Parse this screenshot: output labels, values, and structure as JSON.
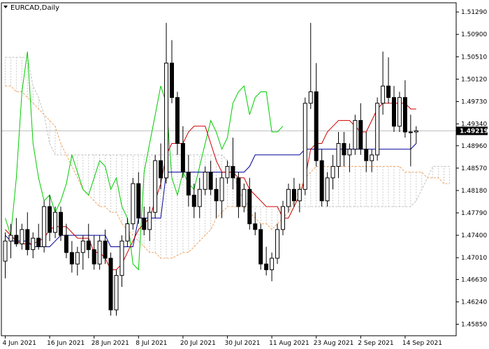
{
  "chart_data": {
    "type": "candlestick",
    "title": "EURCAD,Daily",
    "symbol": "EURCAD",
    "timeframe": "Daily",
    "current_price": 1.49219,
    "current_price_label": "1.49219",
    "ylim": [
      1.4565,
      1.5145
    ],
    "y_ticks": [
      "1.51290",
      "1.50900",
      "1.50510",
      "1.50120",
      "1.49730",
      "1.49340",
      "1.48960",
      "1.48570",
      "1.48180",
      "1.47790",
      "1.47400",
      "1.47010",
      "1.46630",
      "1.46240",
      "1.45850"
    ],
    "x_ticks": [
      {
        "index": 0,
        "label": "4 Jun 2021"
      },
      {
        "index": 8,
        "label": "16 Jun 2021"
      },
      {
        "index": 16,
        "label": "28 Jun 2021"
      },
      {
        "index": 24,
        "label": "8 Jul 2021"
      },
      {
        "index": 32,
        "label": "20 Jul 2021"
      },
      {
        "index": 40,
        "label": "30 Jul 2021"
      },
      {
        "index": 48,
        "label": "11 Aug 2021"
      },
      {
        "index": 56,
        "label": "23 Aug 2021"
      },
      {
        "index": 64,
        "label": "2 Sep 2021"
      },
      {
        "index": 72,
        "label": "14 Sep 2021"
      }
    ],
    "grid": false,
    "colors": {
      "bull_body": "#ffffff",
      "bear_body": "#000000",
      "wick": "#000000",
      "tenkan": "#cc0000",
      "kijun": "#000099",
      "chikou": "#00cc00",
      "span_a": "#f4a460",
      "span_b": "#c0c0c0",
      "price_line": "#c0c0c0",
      "badge_bg": "#000000"
    },
    "candles": [
      [
        1.4695,
        1.4745,
        1.4665,
        1.473
      ],
      [
        1.473,
        1.476,
        1.47,
        1.474
      ],
      [
        1.474,
        1.477,
        1.472,
        1.4725
      ],
      [
        1.4725,
        1.476,
        1.4715,
        1.475
      ],
      [
        1.475,
        1.478,
        1.4705,
        1.4715
      ],
      [
        1.4715,
        1.4745,
        1.47,
        1.4735
      ],
      [
        1.4735,
        1.476,
        1.4715,
        1.472
      ],
      [
        1.472,
        1.48,
        1.471,
        1.479
      ],
      [
        1.479,
        1.481,
        1.473,
        1.4745
      ],
      [
        1.4745,
        1.479,
        1.4735,
        1.478
      ],
      [
        1.478,
        1.479,
        1.473,
        1.474
      ],
      [
        1.474,
        1.476,
        1.47,
        1.471
      ],
      [
        1.471,
        1.473,
        1.4675,
        1.469
      ],
      [
        1.469,
        1.472,
        1.467,
        1.471
      ],
      [
        1.471,
        1.474,
        1.468,
        1.473
      ],
      [
        1.473,
        1.476,
        1.47,
        1.4715
      ],
      [
        1.4715,
        1.474,
        1.468,
        1.469
      ],
      [
        1.469,
        1.474,
        1.468,
        1.473
      ],
      [
        1.473,
        1.475,
        1.469,
        1.47
      ],
      [
        1.47,
        1.471,
        1.46,
        1.461
      ],
      [
        1.461,
        1.468,
        1.46,
        1.467
      ],
      [
        1.467,
        1.474,
        1.465,
        1.473
      ],
      [
        1.473,
        1.477,
        1.472,
        1.476
      ],
      [
        1.476,
        1.484,
        1.475,
        1.483
      ],
      [
        1.483,
        1.485,
        1.476,
        1.477
      ],
      [
        1.477,
        1.479,
        1.474,
        1.475
      ],
      [
        1.475,
        1.479,
        1.473,
        1.478
      ],
      [
        1.478,
        1.488,
        1.477,
        1.487
      ],
      [
        1.487,
        1.49,
        1.482,
        1.484
      ],
      [
        1.484,
        1.511,
        1.483,
        1.504
      ],
      [
        1.504,
        1.508,
        1.497,
        1.498
      ],
      [
        1.498,
        1.499,
        1.488,
        1.49
      ],
      [
        1.49,
        1.493,
        1.484,
        1.485
      ],
      [
        1.485,
        1.488,
        1.479,
        1.481
      ],
      [
        1.481,
        1.483,
        1.477,
        1.479
      ],
      [
        1.479,
        1.484,
        1.477,
        1.482
      ],
      [
        1.482,
        1.486,
        1.481,
        1.485
      ],
      [
        1.485,
        1.487,
        1.481,
        1.482
      ],
      [
        1.482,
        1.484,
        1.477,
        1.48
      ],
      [
        1.48,
        1.485,
        1.477,
        1.484
      ],
      [
        1.484,
        1.487,
        1.483,
        1.486
      ],
      [
        1.486,
        1.491,
        1.482,
        1.484
      ],
      [
        1.484,
        1.485,
        1.477,
        1.479
      ],
      [
        1.479,
        1.483,
        1.478,
        1.482
      ],
      [
        1.482,
        1.484,
        1.475,
        1.476
      ],
      [
        1.476,
        1.478,
        1.474,
        1.475
      ],
      [
        1.475,
        1.476,
        1.468,
        1.469
      ],
      [
        1.469,
        1.472,
        1.467,
        1.468
      ],
      [
        1.468,
        1.471,
        1.466,
        1.47
      ],
      [
        1.47,
        1.476,
        1.469,
        1.475
      ],
      [
        1.475,
        1.48,
        1.474,
        1.479
      ],
      [
        1.479,
        1.483,
        1.478,
        1.482
      ],
      [
        1.482,
        1.484,
        1.479,
        1.48
      ],
      [
        1.48,
        1.483,
        1.478,
        1.482
      ],
      [
        1.482,
        1.498,
        1.481,
        1.497
      ],
      [
        1.497,
        1.511,
        1.496,
        1.499
      ],
      [
        1.499,
        1.504,
        1.486,
        1.487
      ],
      [
        1.487,
        1.489,
        1.479,
        1.48
      ],
      [
        1.48,
        1.485,
        1.479,
        1.484
      ],
      [
        1.484,
        1.488,
        1.482,
        1.486
      ],
      [
        1.486,
        1.492,
        1.484,
        1.49
      ],
      [
        1.49,
        1.492,
        1.486,
        1.488
      ],
      [
        1.488,
        1.49,
        1.485,
        1.489
      ],
      [
        1.489,
        1.495,
        1.488,
        1.494
      ],
      [
        1.494,
        1.497,
        1.488,
        1.489
      ],
      [
        1.489,
        1.492,
        1.485,
        1.487
      ],
      [
        1.487,
        1.489,
        1.485,
        1.488
      ],
      [
        1.488,
        1.498,
        1.487,
        1.497
      ],
      [
        1.497,
        1.506,
        1.495,
        1.5
      ],
      [
        1.5,
        1.505,
        1.497,
        1.498
      ],
      [
        1.498,
        1.5,
        1.492,
        1.493
      ],
      [
        1.493,
        1.499,
        1.492,
        1.498
      ],
      [
        1.498,
        1.501,
        1.491,
        1.492
      ],
      [
        1.492,
        1.495,
        1.486,
        1.492
      ],
      [
        1.492,
        1.493,
        1.49,
        1.4922
      ]
    ],
    "tenkan": [
      1.475,
      1.474,
      1.473,
      1.4725,
      1.4725,
      1.4725,
      1.473,
      1.4735,
      1.475,
      1.4755,
      1.4755,
      1.4755,
      1.4745,
      1.4735,
      1.4735,
      1.4735,
      1.471,
      1.471,
      1.47,
      1.468,
      1.468,
      1.469,
      1.471,
      1.473,
      1.475,
      1.476,
      1.477,
      1.48,
      1.483,
      1.488,
      1.49,
      1.49,
      1.49,
      1.492,
      1.493,
      1.493,
      1.493,
      1.49,
      1.487,
      1.485,
      1.485,
      1.485,
      1.484,
      1.484,
      1.482,
      1.481,
      1.48,
      1.479,
      1.479,
      1.479,
      1.477,
      1.477,
      1.479,
      1.481,
      1.484,
      1.489,
      1.49,
      1.49,
      1.492,
      1.493,
      1.494,
      1.494,
      1.494,
      1.493,
      1.492,
      1.492,
      1.494,
      1.496,
      1.497,
      1.497,
      1.497,
      1.497,
      1.497,
      1.496,
      1.496
    ],
    "kijun": [
      1.474,
      1.473,
      1.473,
      1.473,
      1.473,
      1.472,
      1.472,
      1.472,
      1.472,
      1.473,
      1.474,
      1.474,
      1.474,
      1.474,
      1.474,
      1.474,
      1.474,
      1.474,
      1.474,
      1.472,
      1.472,
      1.472,
      1.472,
      1.472,
      1.477,
      1.477,
      1.477,
      1.477,
      1.477,
      1.485,
      1.485,
      1.485,
      1.485,
      1.485,
      1.485,
      1.485,
      1.485,
      1.485,
      1.485,
      1.485,
      1.485,
      1.485,
      1.485,
      1.485,
      1.486,
      1.488,
      1.488,
      1.488,
      1.488,
      1.488,
      1.488,
      1.488,
      1.488,
      1.488,
      1.489,
      1.489,
      1.489,
      1.489,
      1.489,
      1.489,
      1.489,
      1.489,
      1.489,
      1.489,
      1.489,
      1.489,
      1.489,
      1.489,
      1.489,
      1.489,
      1.489,
      1.489,
      1.489,
      1.489,
      1.49
    ],
    "chikou": [
      1.477,
      1.474,
      1.484,
      1.499,
      1.506,
      1.49,
      1.484,
      1.48,
      1.481,
      1.478,
      1.48,
      1.483,
      1.488,
      1.485,
      1.482,
      1.481,
      1.484,
      1.487,
      1.486,
      1.482,
      1.484,
      1.479,
      1.477,
      1.469,
      1.468,
      1.485,
      1.49,
      1.495,
      1.5,
      1.497,
      1.484,
      1.481,
      1.485,
      1.483,
      1.482,
      1.486,
      1.49,
      1.494,
      1.492,
      1.489,
      1.491,
      1.497,
      1.499,
      1.5,
      1.495,
      1.498,
      1.499,
      1.499,
      1.492,
      1.492,
      1.493
    ],
    "span_a": [
      1.5,
      1.5,
      1.499,
      1.499,
      1.498,
      1.497,
      1.496,
      1.495,
      1.494,
      1.493,
      1.49,
      1.488,
      1.486,
      1.484,
      1.482,
      1.481,
      1.48,
      1.479,
      1.479,
      1.478,
      1.478,
      1.476,
      1.475,
      1.474,
      1.473,
      1.472,
      1.471,
      1.471,
      1.47,
      1.47,
      1.47,
      1.4705,
      1.471,
      1.471,
      1.472,
      1.473,
      1.474,
      1.475,
      1.477,
      1.478,
      1.479,
      1.479,
      1.479,
      1.479,
      1.478,
      1.477,
      1.476,
      1.476,
      1.475,
      1.476,
      1.477,
      1.478,
      1.48,
      1.482,
      1.484,
      1.485,
      1.486,
      1.486,
      1.486,
      1.486,
      1.486,
      1.486,
      1.486,
      1.486,
      1.486,
      1.486,
      1.486,
      1.486,
      1.486,
      1.486,
      1.486,
      1.486,
      1.485,
      1.485,
      1.485,
      1.485,
      1.484,
      1.484,
      1.484,
      1.483,
      1.483,
      1.484,
      1.486
    ],
    "span_b": [
      1.505,
      1.505,
      1.505,
      1.505,
      1.505,
      1.5,
      1.498,
      1.495,
      1.49,
      1.488,
      1.488,
      1.488,
      1.488,
      1.488,
      1.488,
      1.488,
      1.488,
      1.488,
      1.488,
      1.488,
      1.488,
      1.488,
      1.488,
      1.488,
      1.488,
      1.488,
      1.488,
      1.488,
      1.488,
      1.488,
      1.488,
      1.488,
      1.488,
      1.488,
      1.488,
      1.488,
      1.488,
      1.488,
      1.488,
      1.488,
      1.487,
      1.485,
      1.482,
      1.48,
      1.479,
      1.479,
      1.479,
      1.479,
      1.479,
      1.479,
      1.479,
      1.479,
      1.479,
      1.479,
      1.479,
      1.479,
      1.479,
      1.479,
      1.479,
      1.479,
      1.479,
      1.479,
      1.479,
      1.479,
      1.479,
      1.479,
      1.479,
      1.479,
      1.479,
      1.479,
      1.479,
      1.479,
      1.479,
      1.479,
      1.48,
      1.482,
      1.484,
      1.486,
      1.486,
      1.486,
      1.486,
      1.486,
      1.486
    ]
  }
}
